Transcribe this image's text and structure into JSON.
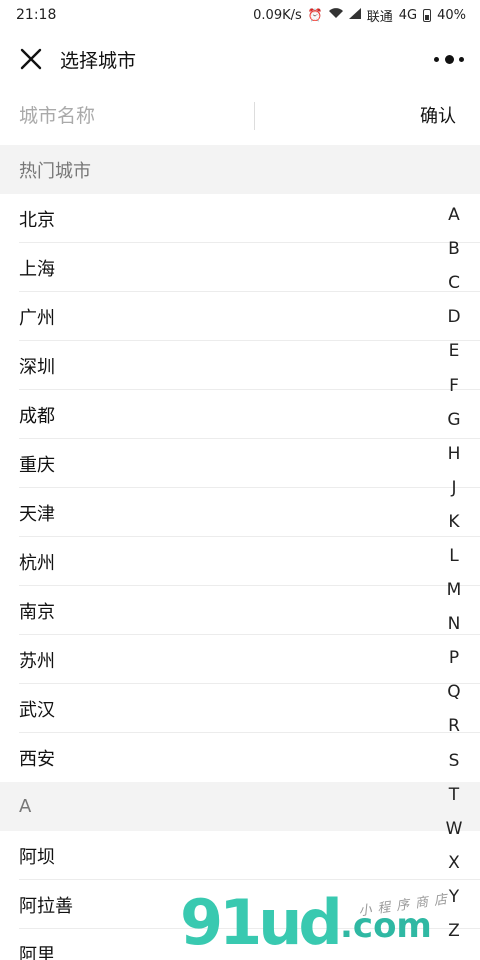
{
  "status_bar": {
    "time": "21:18",
    "speed": "0.09K/s",
    "carrier": "联通",
    "network": "4G",
    "battery": "40%"
  },
  "nav": {
    "title": "选择城市",
    "close_icon": "close-icon",
    "more_icon": "more-icon"
  },
  "search": {
    "placeholder": "城市名称",
    "value": "",
    "confirm_label": "确认"
  },
  "sections": [
    {
      "title": "热门城市",
      "cities": [
        "北京",
        "上海",
        "广州",
        "深圳",
        "成都",
        "重庆",
        "天津",
        "杭州",
        "南京",
        "苏州",
        "武汉",
        "西安"
      ]
    },
    {
      "title": "A",
      "cities": [
        "阿坝",
        "阿拉善",
        "阿里"
      ]
    }
  ],
  "index_letters": [
    "A",
    "B",
    "C",
    "D",
    "E",
    "F",
    "G",
    "H",
    "J",
    "K",
    "L",
    "M",
    "N",
    "P",
    "Q",
    "R",
    "S",
    "T",
    "W",
    "X",
    "Y",
    "Z"
  ],
  "watermark": {
    "logo": "91ud",
    "domain": ".com",
    "tagline": "小程序商店"
  },
  "colors": {
    "section_bg": "#f3f3f3",
    "watermark": "#39c9b0"
  }
}
